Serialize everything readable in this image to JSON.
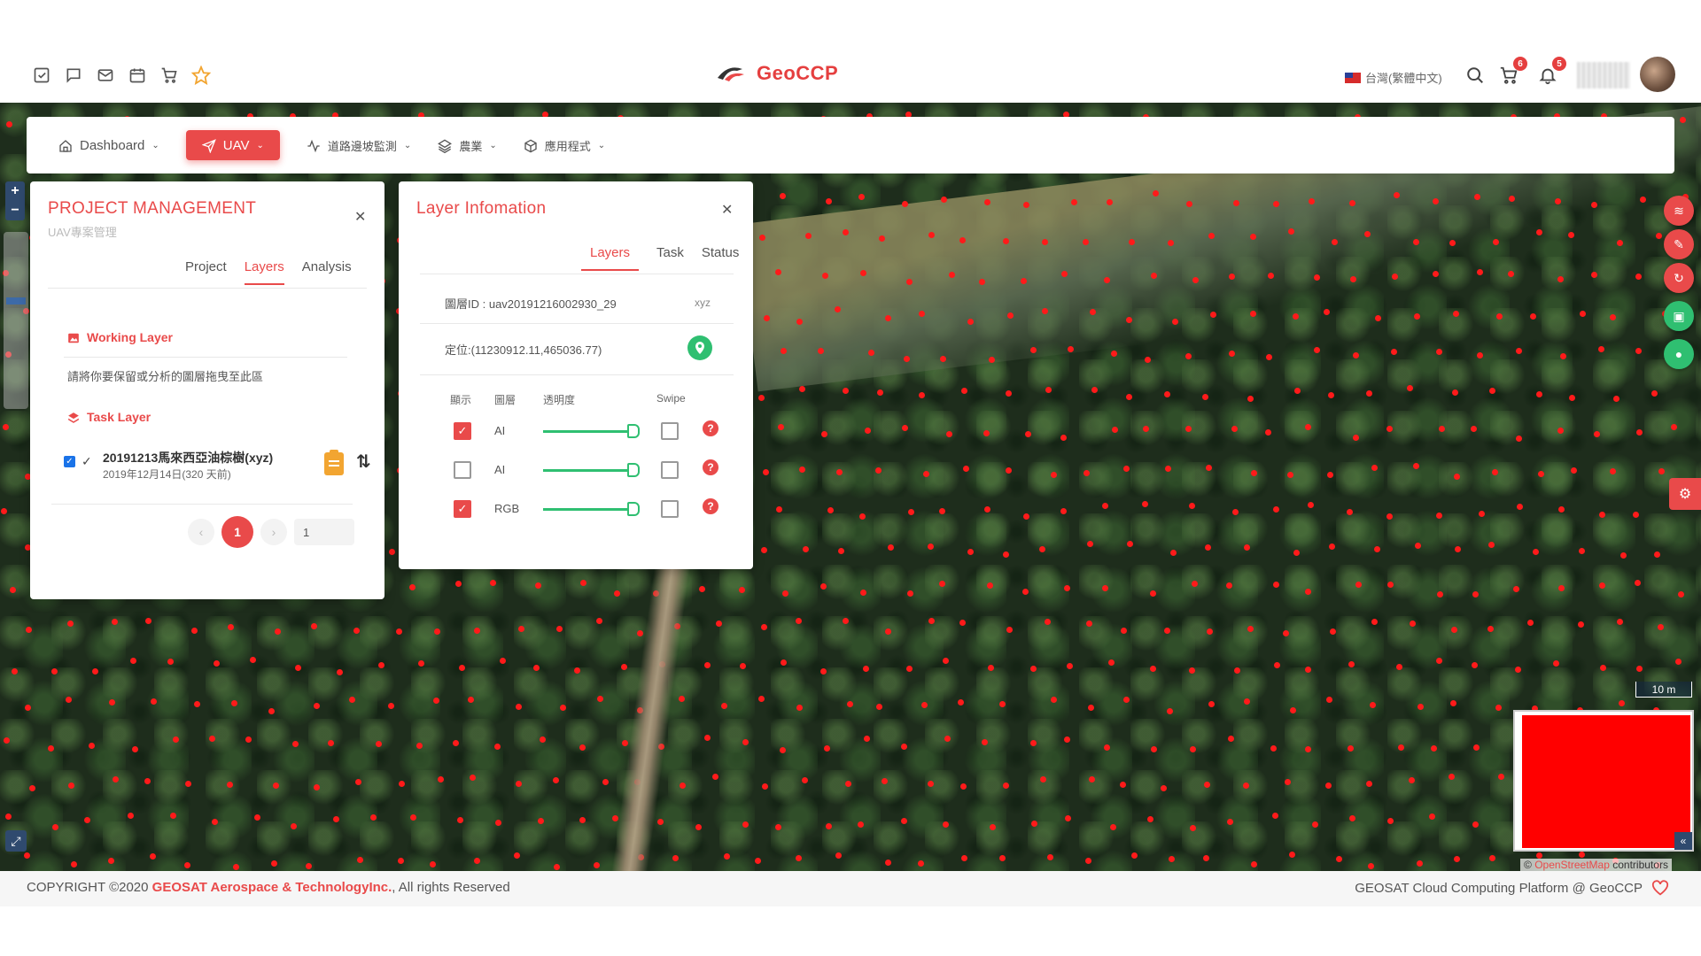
{
  "header": {
    "brand": "GeoCCP",
    "language": "台灣(繁體中文)",
    "cart_count": "6",
    "notification_count": "5",
    "left_icons": [
      "check-square-icon",
      "chat-icon",
      "mail-icon",
      "calendar-icon",
      "cart-icon",
      "star-icon"
    ]
  },
  "nav": {
    "items": [
      {
        "label": "Dashboard",
        "icon": "home-icon"
      },
      {
        "label": "UAV",
        "icon": "send-icon"
      },
      {
        "label": "道路邊坡監測",
        "icon": "activity-icon"
      },
      {
        "label": "農業",
        "icon": "layers-icon"
      },
      {
        "label": "應用程式",
        "icon": "package-icon"
      }
    ]
  },
  "project_panel": {
    "title": "PROJECT MANAGEMENT",
    "subtitle": "UAV專案管理",
    "tabs": [
      "Project",
      "Layers",
      "Analysis"
    ],
    "active_tab": "Layers",
    "working_layer_title": "Working Layer",
    "working_layer_hint": "請將你要保留或分析的圖層拖曳至此區",
    "task_layer_title": "Task Layer",
    "task": {
      "name": "20191213馬來西亞油棕樹(xyz)",
      "date": "2019年12月14日(320 天前)"
    },
    "pager": {
      "prev": "‹",
      "current": "1",
      "next": "›",
      "input_value": "1"
    }
  },
  "layer_panel": {
    "title": "Layer Infomation",
    "tabs": [
      "Layers",
      "Task",
      "Status"
    ],
    "active_tab": "Layers",
    "layer_id": "圖層ID : uav20191216002930_29",
    "layer_type": "xyz",
    "location": "定位:(11230912.11,465036.77)",
    "columns": [
      "顯示",
      "圖層",
      "透明度",
      "Swipe"
    ],
    "rows": [
      {
        "checked": true,
        "name": "AI",
        "opacity": 1.0
      },
      {
        "checked": false,
        "name": "AI",
        "opacity": 1.0
      },
      {
        "checked": true,
        "name": "RGB",
        "opacity": 1.0
      }
    ]
  },
  "map": {
    "scale": "10 m",
    "attribution_prefix": "©",
    "attribution_link": "OpenStreetMap",
    "attribution_suffix": "contributors"
  },
  "footer": {
    "copyright_prefix": "COPYRIGHT ©2020 ",
    "company": "GEOSAT Aerospace & TechnologyInc.",
    "copyright_suffix": ", All rights Reserved",
    "right_text": "GEOSAT Cloud Computing Platform @ GeoCCP"
  },
  "colors": {
    "accent": "#e94a4a",
    "success": "#2fbf71",
    "marker": "#ff1a1a"
  }
}
